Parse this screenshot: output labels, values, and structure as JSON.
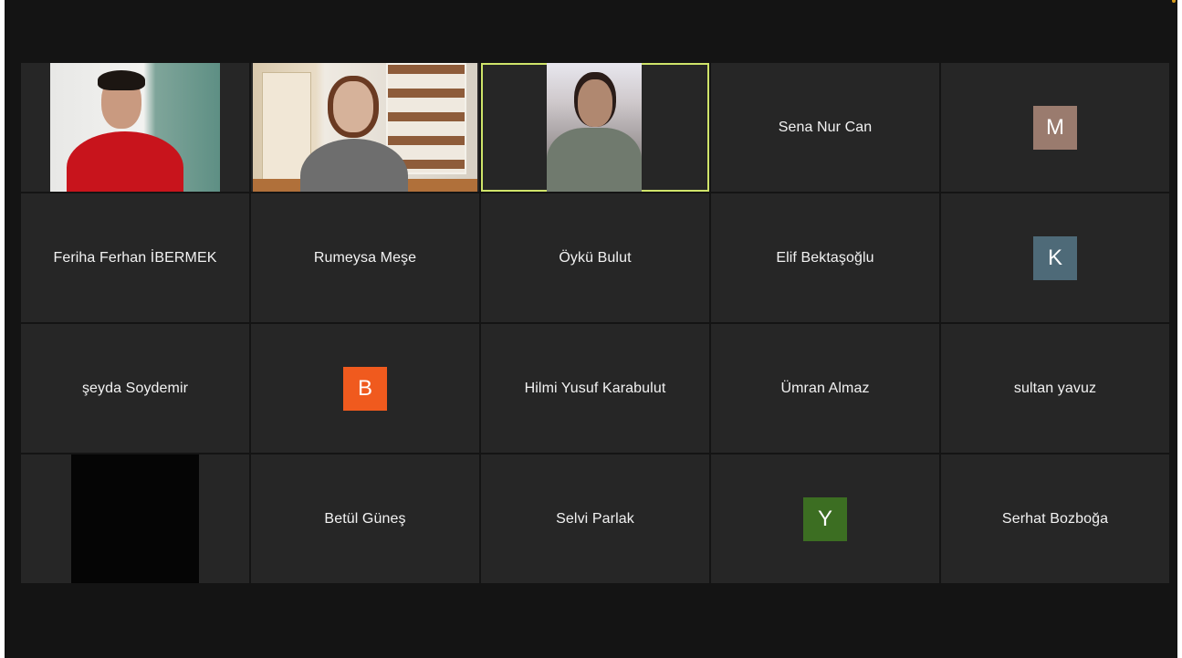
{
  "participants": [
    {
      "id": 1,
      "type": "video"
    },
    {
      "id": 2,
      "type": "video"
    },
    {
      "id": 3,
      "type": "video",
      "active_speaker": true
    },
    {
      "id": 4,
      "type": "name",
      "name": "Sena Nur Can"
    },
    {
      "id": 5,
      "type": "avatar",
      "initial": "M",
      "color": "#9a7b6e"
    },
    {
      "id": 6,
      "type": "name",
      "name": "Feriha Ferhan İBERMEK"
    },
    {
      "id": 7,
      "type": "name",
      "name": "Rumeysa Meşe"
    },
    {
      "id": 8,
      "type": "name",
      "name": "Öykü Bulut"
    },
    {
      "id": 9,
      "type": "name",
      "name": "Elif Bektaşoğlu"
    },
    {
      "id": 10,
      "type": "avatar",
      "initial": "K",
      "color": "#4e6a78"
    },
    {
      "id": 11,
      "type": "name",
      "name": "şeyda Soydemir"
    },
    {
      "id": 12,
      "type": "avatar",
      "initial": "B",
      "color": "#f05a1e"
    },
    {
      "id": 13,
      "type": "name",
      "name": "Hilmi Yusuf Karabulut"
    },
    {
      "id": 14,
      "type": "name",
      "name": "Ümran Almaz"
    },
    {
      "id": 15,
      "type": "name",
      "name": "sultan yavuz"
    },
    {
      "id": 16,
      "type": "video-black"
    },
    {
      "id": 17,
      "type": "name",
      "name": "Betül Güneş"
    },
    {
      "id": 18,
      "type": "name",
      "name": "Selvi Parlak"
    },
    {
      "id": 19,
      "type": "avatar",
      "initial": "Y",
      "color": "#3c6e22"
    },
    {
      "id": 20,
      "type": "name",
      "name": "Serhat Bozboğa"
    }
  ]
}
